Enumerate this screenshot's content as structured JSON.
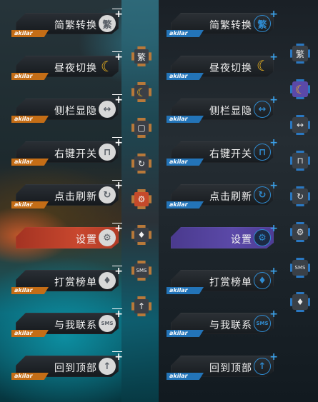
{
  "left_panel": {
    "items": [
      {
        "label": "简繁转换",
        "icon": "繁",
        "plus": "+",
        "brand": "akilar"
      },
      {
        "label": "昼夜切换",
        "icon": "☾",
        "plus": "+",
        "brand": "akilar"
      },
      {
        "label": "侧栏显隐",
        "icon": "↔",
        "plus": "+",
        "brand": "akilar"
      },
      {
        "label": "右键开关",
        "icon": "⊓",
        "plus": "+",
        "brand": "akilar"
      },
      {
        "label": "点击刷新",
        "icon": "↻",
        "plus": "+",
        "brand": "akilar"
      },
      {
        "label": "设置",
        "icon": "⚙",
        "plus": "+",
        "brand": "akilar"
      },
      {
        "label": "打赏榜单",
        "icon": "♦",
        "plus": "+",
        "brand": "akilar"
      },
      {
        "label": "与我联系",
        "icon": "SMS",
        "plus": "+",
        "brand": "akilar"
      },
      {
        "label": "回到顶部",
        "icon": "↑",
        "plus": "+",
        "brand": "akilar"
      }
    ],
    "icons": [
      "繁",
      "☾",
      "▢",
      "↻",
      "⚙",
      "♦",
      "SMS",
      "↑"
    ]
  },
  "right_panel": {
    "items": [
      {
        "label": "简繁转换",
        "icon": "繁",
        "plus": "+",
        "brand": "akilar"
      },
      {
        "label": "昼夜切换",
        "icon": "☾",
        "plus": "+",
        "brand": "akilar"
      },
      {
        "label": "侧栏显隐",
        "icon": "↔",
        "plus": "+",
        "brand": "akilar"
      },
      {
        "label": "右键开关",
        "icon": "⊓",
        "plus": "+",
        "brand": "akilar"
      },
      {
        "label": "点击刷新",
        "icon": "↻",
        "plus": "+",
        "brand": "akilar"
      },
      {
        "label": "设置",
        "icon": "⚙",
        "plus": "+",
        "brand": "akilar"
      },
      {
        "label": "打赏榜单",
        "icon": "♦",
        "plus": "+",
        "brand": "akilar"
      },
      {
        "label": "与我联系",
        "icon": "SMS",
        "plus": "+",
        "brand": "akilar"
      },
      {
        "label": "回到顶部",
        "icon": "↑",
        "plus": "+",
        "brand": "akilar"
      }
    ],
    "icons": [
      "繁",
      "☾",
      "↔",
      "⊓",
      "↻",
      "⚙",
      "SMS",
      "♦"
    ]
  },
  "colors": {
    "left_accent": "#c46d16",
    "left_active": "#c8472e",
    "right_accent": "#2374b8",
    "right_active": "#5b49a8",
    "moon": "#f2b81f"
  }
}
